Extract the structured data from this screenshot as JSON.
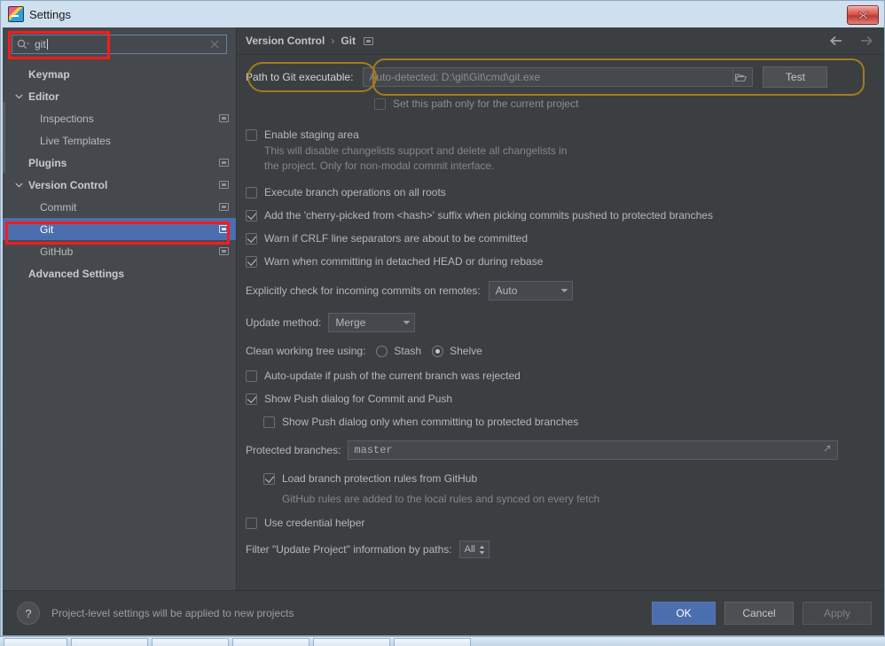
{
  "window": {
    "title": "Settings",
    "icon": "app-icon",
    "close_label": "×"
  },
  "search": {
    "value": "git",
    "placeholder": "",
    "icon": "search-icon",
    "clear_icon": "clear-icon"
  },
  "sidebar": {
    "items": [
      {
        "label": "Keymap",
        "bold": true,
        "indent": 0,
        "twisty": "none",
        "badge": false,
        "selected": false
      },
      {
        "label": "Editor",
        "bold": true,
        "indent": 0,
        "twisty": "expanded",
        "badge": false,
        "selected": false
      },
      {
        "label": "Inspections",
        "bold": false,
        "indent": 1,
        "twisty": "none",
        "badge": true,
        "selected": false
      },
      {
        "label": "Live Templates",
        "bold": false,
        "indent": 1,
        "twisty": "none",
        "badge": false,
        "selected": false
      },
      {
        "label": "Plugins",
        "bold": true,
        "indent": 0,
        "twisty": "none",
        "badge": true,
        "selected": false
      },
      {
        "label": "Version Control",
        "bold": true,
        "indent": 0,
        "twisty": "expanded",
        "badge": true,
        "selected": false
      },
      {
        "label": "Commit",
        "bold": false,
        "indent": 1,
        "twisty": "none",
        "badge": true,
        "selected": false
      },
      {
        "label": "Git",
        "bold": false,
        "indent": 1,
        "twisty": "none",
        "badge": true,
        "selected": true
      },
      {
        "label": "GitHub",
        "bold": false,
        "indent": 1,
        "twisty": "none",
        "badge": true,
        "selected": false
      },
      {
        "label": "Advanced Settings",
        "bold": true,
        "indent": 0,
        "twisty": "none",
        "badge": false,
        "selected": false
      }
    ]
  },
  "breadcrumb": {
    "parent": "Version Control",
    "separator": "›",
    "current": "Git",
    "back_icon": "arrow-left-icon",
    "forward_icon": "arrow-right-icon"
  },
  "main": {
    "path_row": {
      "label": "Path to Git executable:",
      "value": "",
      "placeholder": "Auto-detected: D:\\git\\Git\\cmd\\git.exe",
      "browse_icon": "folder-icon",
      "test_button": "Test"
    },
    "set_path_only_current_project": {
      "label": "Set this path only for the current project",
      "checked": false
    },
    "enable_staging_area": {
      "label": "Enable staging area",
      "checked": false,
      "help_line1": "This will disable changelists support and delete all changelists in",
      "help_line2": "the project. Only for non-modal commit interface."
    },
    "execute_branch_operations": {
      "label": "Execute branch operations on all roots",
      "checked": false
    },
    "cherry_picked_suffix": {
      "label": "Add the 'cherry-picked from <hash>' suffix when picking commits pushed to protected branches",
      "checked": true
    },
    "warn_crlf": {
      "label": "Warn if CRLF line separators are about to be committed",
      "checked": true
    },
    "warn_detached_head": {
      "label": "Warn when committing in detached HEAD or during rebase",
      "checked": true
    },
    "incoming_commits": {
      "label": "Explicitly check for incoming commits on remotes:",
      "value": "Auto"
    },
    "update_method": {
      "label": "Update method:",
      "value": "Merge"
    },
    "clean_working_tree": {
      "label": "Clean working tree using:",
      "options": [
        "Stash",
        "Shelve"
      ],
      "selected": "Shelve"
    },
    "auto_update_rejected": {
      "label": "Auto-update if push of the current branch was rejected",
      "checked": false
    },
    "show_push_dialog": {
      "label": "Show Push dialog for Commit and Push",
      "checked": true
    },
    "show_push_dialog_protected": {
      "label": "Show Push dialog only when committing to protected branches",
      "checked": false
    },
    "protected_branches": {
      "label": "Protected branches:",
      "value": "master",
      "expand_icon": "expand-icon"
    },
    "load_branch_protection": {
      "label": "Load branch protection rules from GitHub",
      "checked": true,
      "help": "GitHub rules are added to the local rules and synced on every fetch"
    },
    "use_credential_helper": {
      "label": "Use credential helper",
      "checked": false
    },
    "filter_update_project": {
      "label": "Filter \"Update Project\" information by paths:",
      "value": "All"
    }
  },
  "footer": {
    "help_icon": "?",
    "note": "Project-level settings will be applied to new projects",
    "ok": "OK",
    "cancel": "Cancel",
    "apply": "Apply"
  },
  "colors": {
    "accent": "#4b6eaf",
    "panel_bg": "#3c3f41",
    "sidebar_bg": "#45494d",
    "annotation_red": "#ff1a1a",
    "annotation_orange": "#a37b21"
  }
}
